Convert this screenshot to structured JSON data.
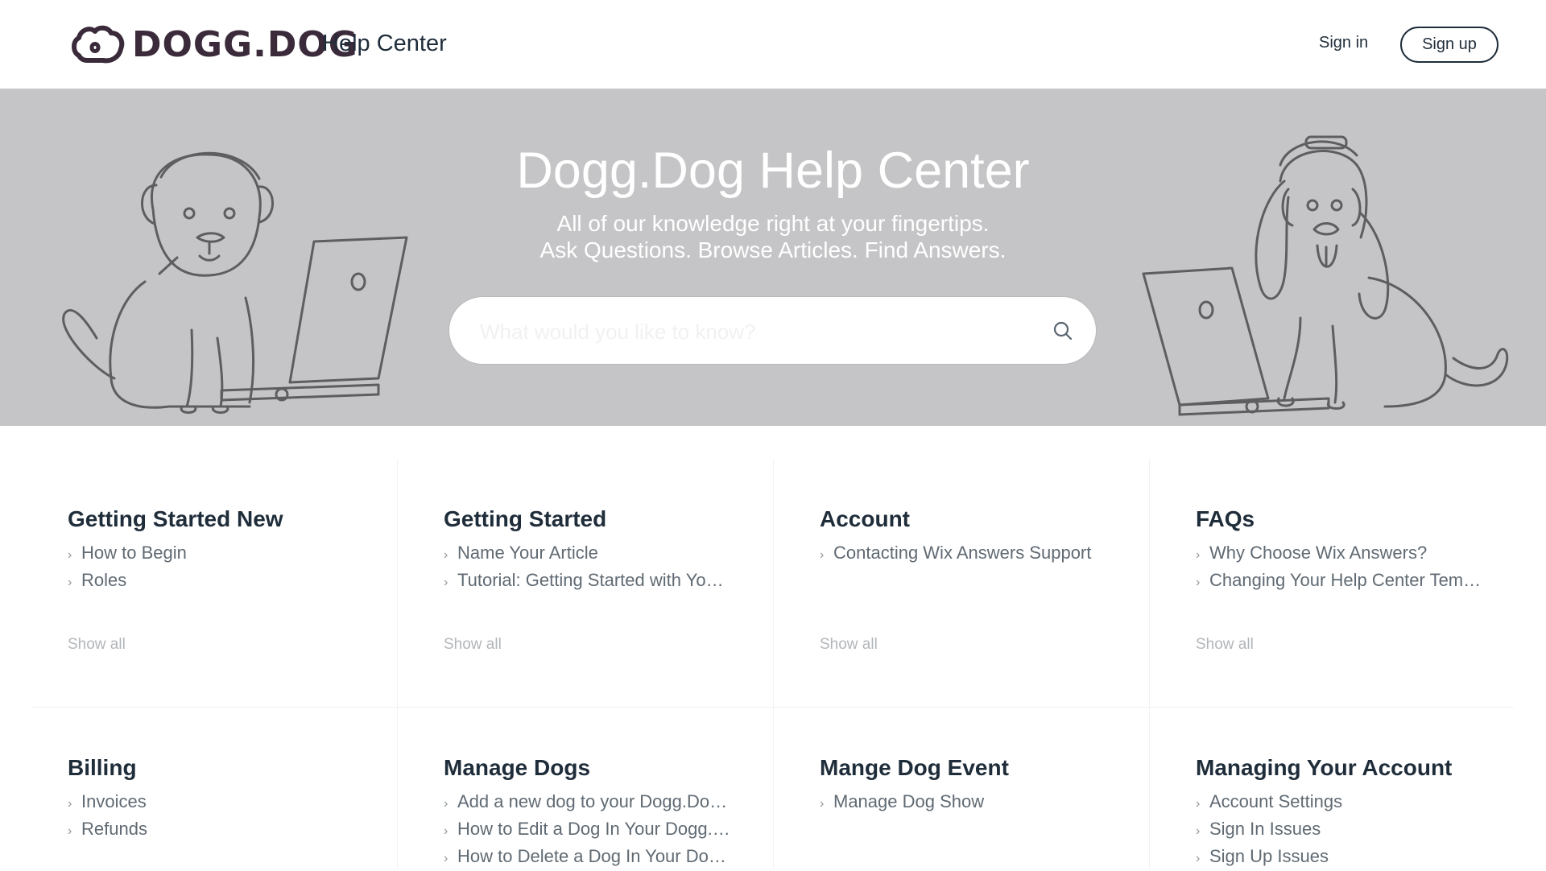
{
  "header": {
    "logo_text": "DOGG.DOG",
    "title": "Help Center",
    "signin_label": "Sign in",
    "signup_label": "Sign up"
  },
  "hero": {
    "title": "Dogg.Dog Help Center",
    "subtitle_line1": "All of our knowledge right at your fingertips.",
    "subtitle_line2": "Ask Questions. Browse Articles. Find Answers.",
    "search_placeholder": "What would you like to know?",
    "background_color": "#c5c5c7"
  },
  "categories": [
    {
      "title": "Getting Started New",
      "articles": [
        "How to Begin",
        "Roles"
      ],
      "show_all": "Show all"
    },
    {
      "title": "Getting Started",
      "articles": [
        "Name Your Article",
        "Tutorial: Getting Started with Yo…"
      ],
      "show_all": "Show all"
    },
    {
      "title": "Account",
      "articles": [
        "Contacting Wix Answers Support"
      ],
      "show_all": "Show all"
    },
    {
      "title": "FAQs",
      "articles": [
        "Why Choose Wix Answers?",
        "Changing Your Help Center Tem…"
      ],
      "show_all": "Show all"
    },
    {
      "title": "Billing",
      "articles": [
        "Invoices",
        "Refunds"
      ]
    },
    {
      "title": "Manage Dogs",
      "articles": [
        "Add a new dog to your Dogg.Do…",
        "How to Edit a Dog In Your Dogg.…",
        "How to Delete a Dog In Your Do…"
      ]
    },
    {
      "title": "Mange Dog Event",
      "articles": [
        "Manage Dog Show"
      ]
    },
    {
      "title": "Managing Your Account",
      "articles": [
        "Account Settings",
        "Sign In Issues",
        "Sign Up Issues"
      ]
    }
  ],
  "icons": {
    "logo": "dog-outline-logo-icon",
    "search": "search-icon",
    "bullet": "chevron-right-icon"
  },
  "colors": {
    "text_dark": "#1f2d3a",
    "article_text": "#606a73",
    "show_all": "#b2b6ba"
  }
}
